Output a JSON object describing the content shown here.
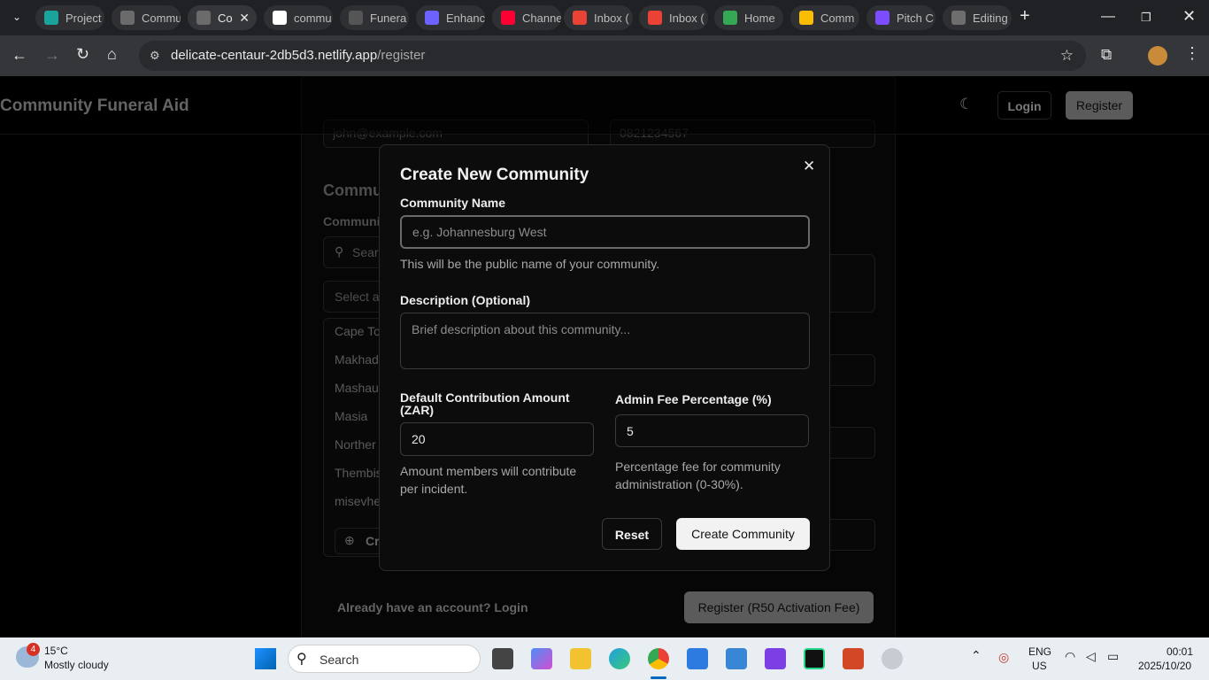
{
  "browser": {
    "tabs": [
      {
        "label": "Project",
        "color": "#1aa39a",
        "active": false
      },
      {
        "label": "Commu",
        "color": "#6b6b6b",
        "active": false
      },
      {
        "label": "Co",
        "color": "#6b6b6b",
        "active": true
      },
      {
        "label": "commu",
        "color": "#ffffff",
        "active": false
      },
      {
        "label": "Funera",
        "color": "#555555",
        "active": false
      },
      {
        "label": "Enhanc",
        "color": "#6c63ff",
        "active": false
      },
      {
        "label": "Channe",
        "color": "#ff0033",
        "active": false
      },
      {
        "label": "Inbox (",
        "color": "#ea4335",
        "active": false
      },
      {
        "label": "Inbox (",
        "color": "#ea4335",
        "active": false
      },
      {
        "label": "Home",
        "color": "#34a853",
        "active": false
      },
      {
        "label": "Comm",
        "color": "#fbbc04",
        "active": false
      },
      {
        "label": "Pitch C",
        "color": "#7c4dff",
        "active": false
      },
      {
        "label": "Editing",
        "color": "#6e6e6e",
        "active": false
      }
    ],
    "url_domain": "delicate-centaur-2db5d3.netlify.app",
    "url_path": "/register"
  },
  "site": {
    "brand": "Community Funeral Aid",
    "login_label": "Login",
    "register_label": "Register"
  },
  "background_form": {
    "email_value": "john@example.com",
    "phone_value": "0821234567",
    "section_heading": "Commu",
    "community_label": "Communi",
    "search_placeholder": "Searc",
    "select_placeholder": "Select a",
    "communities": [
      "Cape To",
      "Makhad",
      "Mashau",
      "Masia",
      "Norther",
      "Thembis",
      "misevhe"
    ],
    "create_label": "Cr",
    "already_account": "Already have an account? Login",
    "register_button": "Register (R50 Activation Fee)"
  },
  "modal": {
    "title": "Create New Community",
    "close_glyph": "✕",
    "name_label": "Community Name",
    "name_placeholder": "e.g. Johannesburg West",
    "name_help": "This will be the public name of your community.",
    "description_label": "Description (Optional)",
    "description_placeholder": "Brief description about this community...",
    "contribution_label": "Default Contribution Amount (ZAR)",
    "contribution_value": "20",
    "contribution_help": "Amount members will contribute per incident.",
    "fee_label": "Admin Fee Percentage (%)",
    "fee_value": "5",
    "fee_help": "Percentage fee for community administration (0-30%).",
    "reset_label": "Reset",
    "create_label": "Create Community"
  },
  "taskbar": {
    "weather_badge": "4",
    "weather_temp": "15°C",
    "weather_desc": "Mostly cloudy",
    "search_label": "Search",
    "lang_top": "ENG",
    "lang_bottom": "US",
    "time": "00:01",
    "date": "2025/10/20"
  }
}
